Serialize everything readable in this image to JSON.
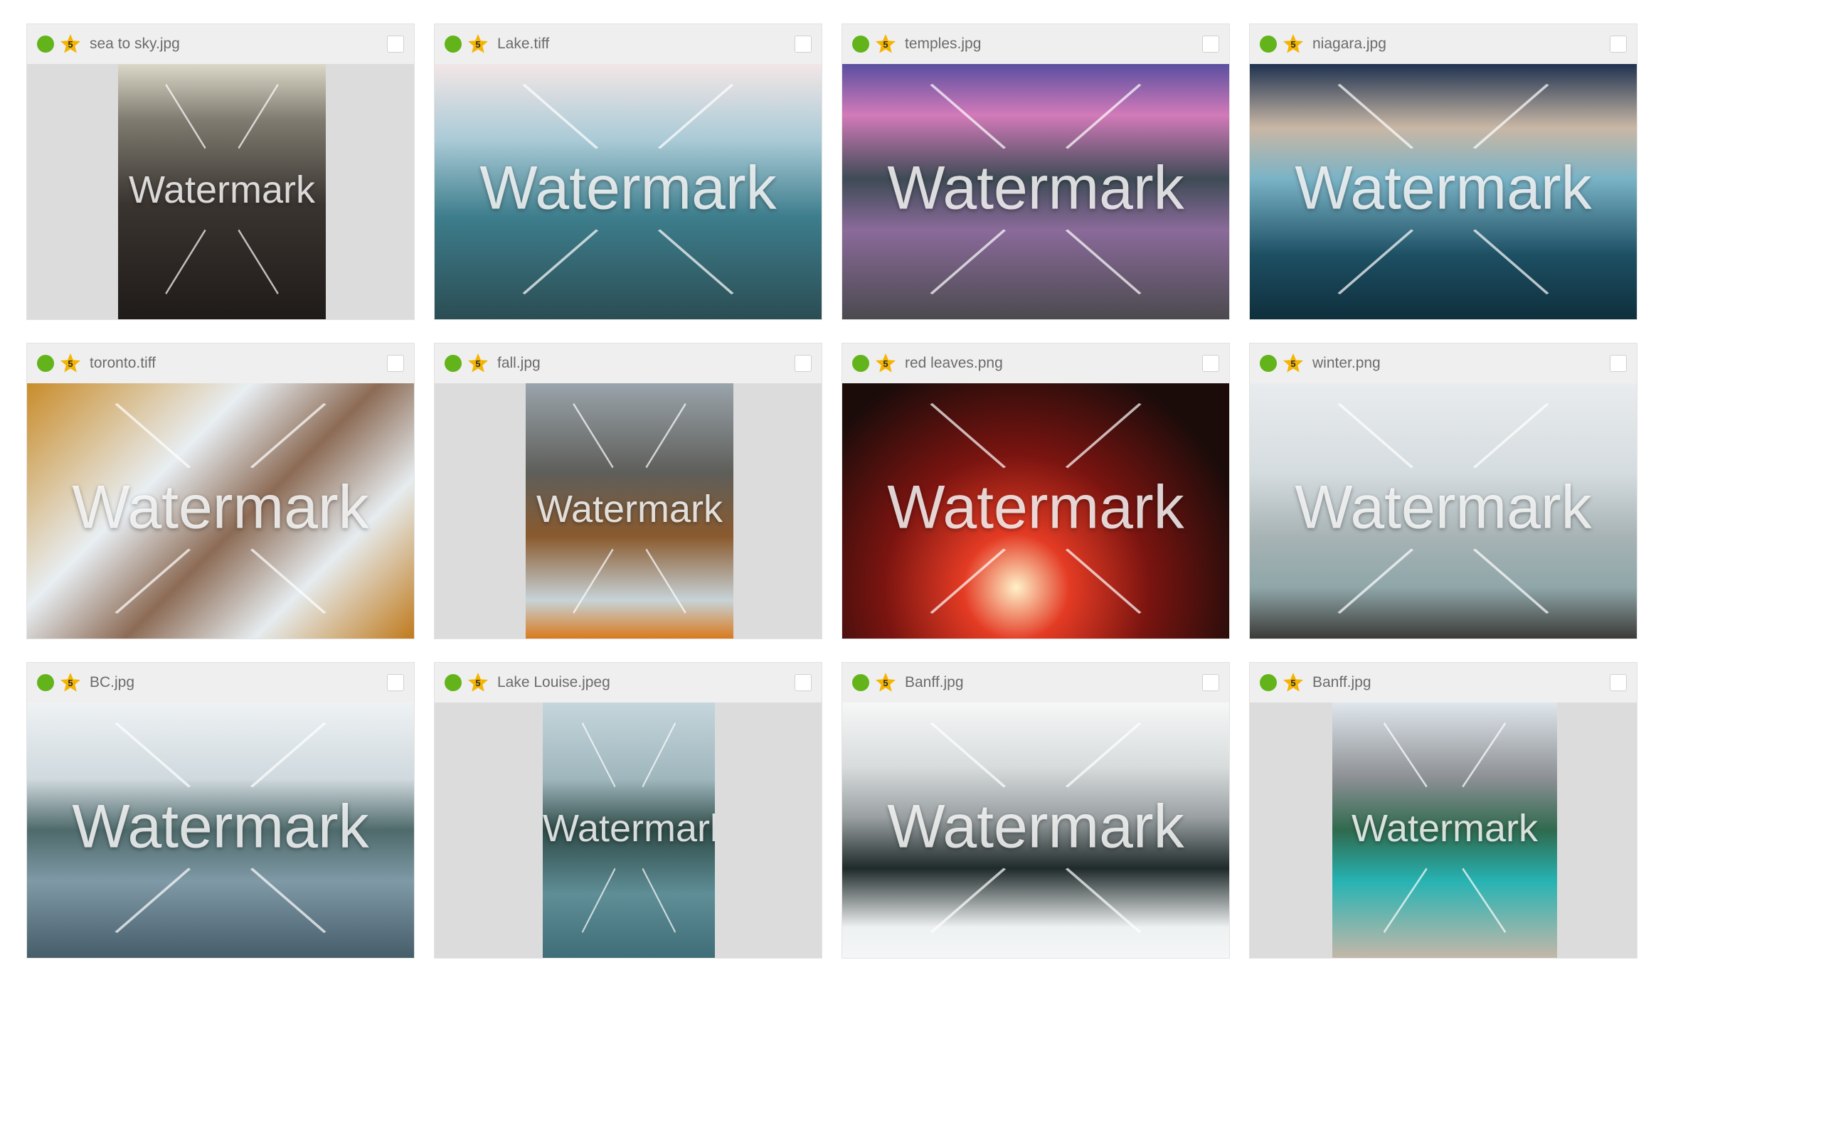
{
  "gallery": {
    "items": [
      {
        "name": "sea to sky.jpg",
        "rating": "5",
        "watermark": "Watermark",
        "orientation": "portrait",
        "bg": "linear-gradient(180deg,#dcd8c8 0%,#7f7b70 22%,#3a3430 55%,#1f1b18 100%)"
      },
      {
        "name": "Lake.tiff",
        "rating": "5",
        "watermark": "Watermark",
        "orientation": "landscape",
        "bg": "linear-gradient(180deg,#f3e6e6 0%,#a9cad6 30%,#3d7d8c 60%,#2b4d53 100%)"
      },
      {
        "name": "temples.jpg",
        "rating": "5",
        "watermark": "Watermark",
        "orientation": "landscape",
        "bg": "linear-gradient(180deg,#5a4fa0 0%,#d27ab9 20%,#3e4b55 45%,#8a6a9a 65%,#4b4a4e 100%)"
      },
      {
        "name": "niagara.jpg",
        "rating": "5",
        "watermark": "Watermark",
        "orientation": "landscape",
        "bg": "linear-gradient(180deg,#1f3250 0%,#c9b7a5 25%,#7ab3c6 45%,#1d4f63 75%,#0f2f3c 100%)"
      },
      {
        "name": "toronto.tiff",
        "rating": "5",
        "watermark": "Watermark",
        "orientation": "landscape",
        "bg": "linear-gradient(135deg,#c98c2a 0%,#e8eef2 35%,#8c6b55 55%,#e6ecef 75%,#c07a1c 100%)"
      },
      {
        "name": "fall.jpg",
        "rating": "5",
        "watermark": "Watermark",
        "orientation": "portrait",
        "bg": "linear-gradient(180deg,#9aa4ab 0%,#5e5e5a 35%,#8a5a2e 60%,#c7d3d8 85%,#d97a1e 100%)"
      },
      {
        "name": "red leaves.png",
        "rating": "5",
        "watermark": "Watermark",
        "orientation": "landscape",
        "bg": "radial-gradient(circle at 45% 80%,#fff1c8 0%,#e43b24 18%,#7a1410 45%,#1b0c0a 80%)"
      },
      {
        "name": "winter.png",
        "rating": "5",
        "watermark": "Watermark",
        "orientation": "landscape",
        "bg": "linear-gradient(180deg,#e9ecee 0%,#d5dcdf 35%,#a7b3b5 60%,#8fa6a9 80%,#3b3b38 100%)"
      },
      {
        "name": "BC.jpg",
        "rating": "5",
        "watermark": "Watermark",
        "orientation": "landscape",
        "bg": "linear-gradient(180deg,#eef2f4 0%,#cfd9de 30%,#4f6a6b 50%,#7f99a6 70%,#465d6a 100%)"
      },
      {
        "name": "Lake Louise.jpeg",
        "rating": "5",
        "watermark": "Watermark",
        "orientation": "portrait",
        "bg": "linear-gradient(180deg,#c5d6dc 0%,#9fb6bd 30%,#2f4c48 50%,#5f8e97 75%,#3f6d78 100%)"
      },
      {
        "name": "Banff.jpg",
        "rating": "5",
        "watermark": "Watermark",
        "orientation": "landscape",
        "bg": "linear-gradient(180deg,#f6f7f7 0%,#d8dcdd 25%,#9aa0a2 45%,#1f2a2a 65%,#eef1f2 88%,#f4f6f7 100%)"
      },
      {
        "name": "Banff.jpg",
        "rating": "5",
        "watermark": "Watermark",
        "orientation": "portrait",
        "bg": "linear-gradient(180deg,#dfe6ec 0%,#8b8f93 30%,#2f6a4e 50%,#27b3b3 70%,#c4b7a8 100%)"
      }
    ]
  },
  "colors": {
    "status_green": "#63b41b",
    "star_gold": "#f4b400",
    "header_bg": "#efefef",
    "image_bg": "#dcdcdc"
  },
  "icons": {
    "status": "status-dot-icon",
    "rating": "star-icon",
    "select": "checkbox-icon"
  }
}
